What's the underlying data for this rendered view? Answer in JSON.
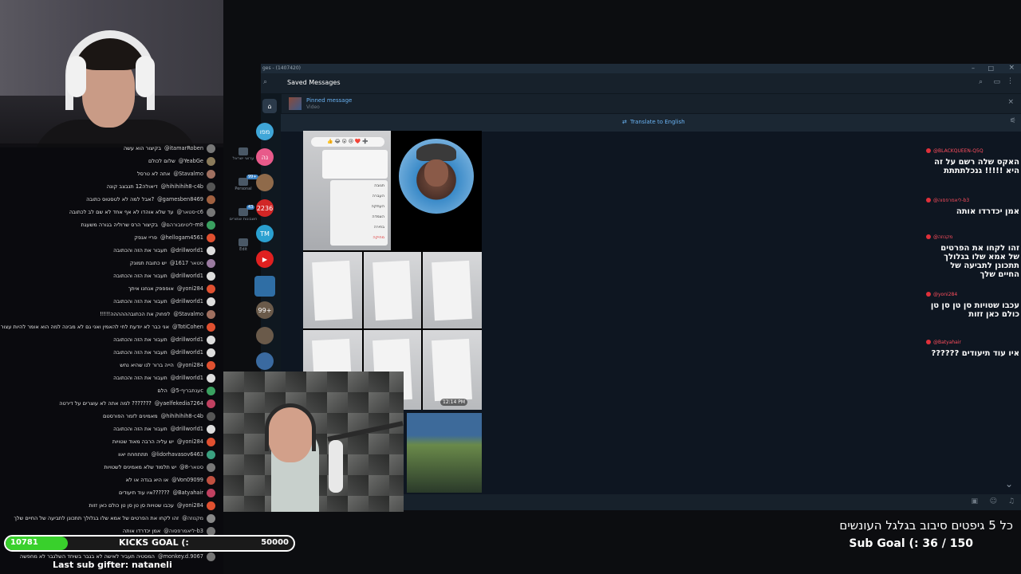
{
  "telegram": {
    "window_title": "ges - (1407420)",
    "chat_title": "Saved Messages",
    "pinned_label": "Pinned message",
    "pinned_sub": "Video",
    "translate_label": "Translate to English",
    "msg_time": "12:14 PM",
    "folders": [
      {
        "label": "ערוצי ישראל",
        "badge": ""
      },
      {
        "label": "Personal",
        "badge": "99+"
      },
      {
        "label": "חשבונות שמורים",
        "badge": "43"
      },
      {
        "label": "Edit",
        "badge": ""
      }
    ],
    "chat_avatars": [
      {
        "text": "מפו",
        "color": "#3fa6d8"
      },
      {
        "text": "נה",
        "color": "#e85a8a"
      },
      {
        "text": "",
        "color": "#8f6a4a"
      },
      {
        "text": "2236",
        "color": "#d12626"
      },
      {
        "text": "TM",
        "color": "#2aa0d0"
      },
      {
        "text": "▶",
        "color": "#e02020"
      },
      {
        "text": "",
        "color": "#2f6ea5"
      },
      {
        "text": "99+",
        "color": "#6a5a4a"
      },
      {
        "text": "",
        "color": "#6a5a4a"
      },
      {
        "text": "",
        "color": "#3a6aa0"
      }
    ],
    "story_emojis": "👍 😂 😮 😢 ❤️ ➕",
    "story_menu": [
      "תגובה",
      "העברה",
      "העתקה",
      "הצמדה",
      "בחירה",
      "מחיקה"
    ]
  },
  "chat": [
    {
      "user": "@itamarRoben",
      "msg": "בקיצור הוא עשה",
      "color": "#777"
    },
    {
      "user": "@YeabGe",
      "msg": "שלום לכולם",
      "color": "#8a7a5a"
    },
    {
      "user": "@Stavalmo",
      "msg": "אתה לא טרסל",
      "color": "#a07060"
    },
    {
      "user": "@hihihihih8-c4b",
      "msg": "דיאולה12 תנבצב קונה",
      "color": "#555"
    },
    {
      "user": "@gamesben8469",
      "msg": "אבל למה לא לטסטוס כתובה?",
      "color": "#a06040"
    },
    {
      "user": "@סטאר-c6",
      "msg": "עד שלא אוהדו לא אף אחד לא שם לב לכתובה",
      "color": "#777"
    },
    {
      "user": "@ליטימבורהם-m8",
      "msg": "בקיצור הרס שרוליה בגורה משעגת",
      "color": "#3aa060"
    },
    {
      "user": "@hellogam4561",
      "msg": "פריי אנפק",
      "color": "#e05030"
    },
    {
      "user": "@drillworld1",
      "msg": "תעבור את הזה והכתובה",
      "color": "#ddd"
    },
    {
      "user": "@סטאר 1617",
      "msg": "יש כתובת תמונק",
      "color": "#9a7aa0"
    },
    {
      "user": "@drillworld1",
      "msg": "תעבור את הזה והכתובה",
      "color": "#ddd"
    },
    {
      "user": "@yoni284",
      "msg": "אופפפק אנחנו איתך",
      "color": "#e05030"
    },
    {
      "user": "@drillworld1",
      "msg": "תעבור את הזה והכתובה",
      "color": "#ddd"
    },
    {
      "user": "@Stavalmo",
      "msg": "!!!!!לפחוק את הכתובהההההה",
      "color": "#a07060"
    },
    {
      "user": "@TotiCohen",
      "msg": "אני כבר לא יודעת לחי להאמין ואני גם לא מבינה למה הוא אומר להיות עצור",
      "color": "#e05030"
    },
    {
      "user": "@drillworld1",
      "msg": "תעבור את הזה והכתובה",
      "color": "#ddd"
    },
    {
      "user": "@drillworld1",
      "msg": "תעבור את הזה והכתובה",
      "color": "#ddd"
    },
    {
      "user": "@yoni284",
      "msg": "הייה ברור לנו שהיא נחש",
      "color": "#e05030"
    },
    {
      "user": "@drillworld1",
      "msg": "תעבור את הזה והכתובה",
      "color": "#ddd"
    },
    {
      "user": "@ענתבריף-5c",
      "msg": "הלם",
      "color": "#3aa060"
    },
    {
      "user": "@yaelfekedia7264",
      "msg": "למה אתה לא עוצרים על דירטה ???????",
      "color": "#c04060"
    },
    {
      "user": "@hihihihih8-c4b",
      "msg": "מאמינים לזמר הפורסטם",
      "color": "#555"
    },
    {
      "user": "@drillworld1",
      "msg": "תעבור את הזה והכתובה",
      "color": "#ddd"
    },
    {
      "user": "@yoni284",
      "msg": "יש עליה הרבה מאוד שטויות",
      "color": "#e05030"
    },
    {
      "user": "@lidorhavasov6463",
      "msg": "תתתחחח יאוו",
      "color": "#3aa080"
    },
    {
      "user": "@סטאר-8",
      "msg": "יש תלמוד שלא מאמינים לשטויות",
      "color": "#777"
    },
    {
      "user": "@Von09099",
      "msg": "או היא בגדה או לא",
      "color": "#c05040"
    },
    {
      "user": "@Batyahair",
      "msg": "איו עוד תיעודים??????",
      "color": "#c04060"
    },
    {
      "user": "@yoni284",
      "msg": "עכבו שטויות סן טן סן טן כולם כאן זזות",
      "color": "#e05030"
    },
    {
      "user": "@מקנוזה",
      "msg": "זהו לקחו את הפרטים של אמא שלו בגלולך תתכונן לתביעה של החיים שלך",
      "color": "#888"
    },
    {
      "user": "@ליאמרפסוה-b3",
      "msg": "אמן יכדרדו אותה",
      "color": "#777"
    },
    {
      "user": "@מקנוזה-c6",
      "msg": "האקס שלה רשם על זה היא !!!!! גנכלתתתת",
      "color": "#c04060"
    },
    {
      "user": "@monkey.d.9067",
      "msg": "המסטיה תעביר לאישה לא בגבר בשיחד השלגבר לא מחפשה",
      "color": "#777"
    }
  ],
  "overlay": {
    "right_feed": [
      {
        "user": "@BLACKQUEEN-Q5Q",
        "msg": "האקס שלה רשם על זה היא !!!!! גנכלתתתת"
      },
      {
        "user": "@ליאמרפסוה-b3",
        "msg": "אמן יכדרדו אותה"
      },
      {
        "user": "@מקנוזה",
        "msg": "זהו לקחו את הפרטים של אמא שלו בגלולך תתכונן לתביעה של החיים שלך"
      },
      {
        "user": "@yoni284",
        "msg": "עכבו שטויות סן טן סן טן כולם כאן זזות"
      },
      {
        "user": "@Batyahair",
        "msg": "?????? איו עוד תיעודים"
      }
    ],
    "spin_text": "כל 5 גיפטים סיבוב בגלגל העונשים",
    "sub_goal": "Sub Goal (: 36 / 150",
    "kicks_current": "10781",
    "kicks_label": "KICKS GOAL (:",
    "kicks_target": "50000",
    "kicks_progress": 0.2156,
    "last_sub": "Last sub gifter: nataneli"
  }
}
